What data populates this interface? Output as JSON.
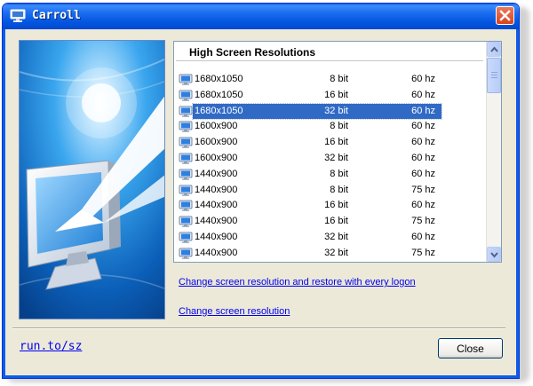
{
  "window": {
    "title": "Carroll",
    "title_icon": "monitor-icon",
    "close_icon": "close-icon"
  },
  "list": {
    "header": "High Screen Resolutions",
    "row_icon": "monitor-icon",
    "selected_index": 2,
    "rows": [
      {
        "res": "1680x1050",
        "bit": "8 bit",
        "hz": "60 hz"
      },
      {
        "res": "1680x1050",
        "bit": "16 bit",
        "hz": "60 hz"
      },
      {
        "res": "1680x1050",
        "bit": "32 bit",
        "hz": "60 hz"
      },
      {
        "res": "1600x900",
        "bit": "8 bit",
        "hz": "60 hz"
      },
      {
        "res": "1600x900",
        "bit": "16 bit",
        "hz": "60 hz"
      },
      {
        "res": "1600x900",
        "bit": "32 bit",
        "hz": "60 hz"
      },
      {
        "res": "1440x900",
        "bit": "8 bit",
        "hz": "60 hz"
      },
      {
        "res": "1440x900",
        "bit": "8 bit",
        "hz": "75 hz"
      },
      {
        "res": "1440x900",
        "bit": "16 bit",
        "hz": "60 hz"
      },
      {
        "res": "1440x900",
        "bit": "16 bit",
        "hz": "75 hz"
      },
      {
        "res": "1440x900",
        "bit": "32 bit",
        "hz": "60 hz"
      },
      {
        "res": "1440x900",
        "bit": "32 bit",
        "hz": "75 hz"
      }
    ]
  },
  "links": {
    "restore": "Change screen resolution and restore with every logon",
    "change": "Change screen resolution"
  },
  "footer": {
    "link": "run.to/sz",
    "close_button": "Close"
  },
  "colors": {
    "titlebar": "#0a5fe6",
    "selection": "#316ac5",
    "link": "#0000ee",
    "dialog_bg": "#ece9d8"
  }
}
